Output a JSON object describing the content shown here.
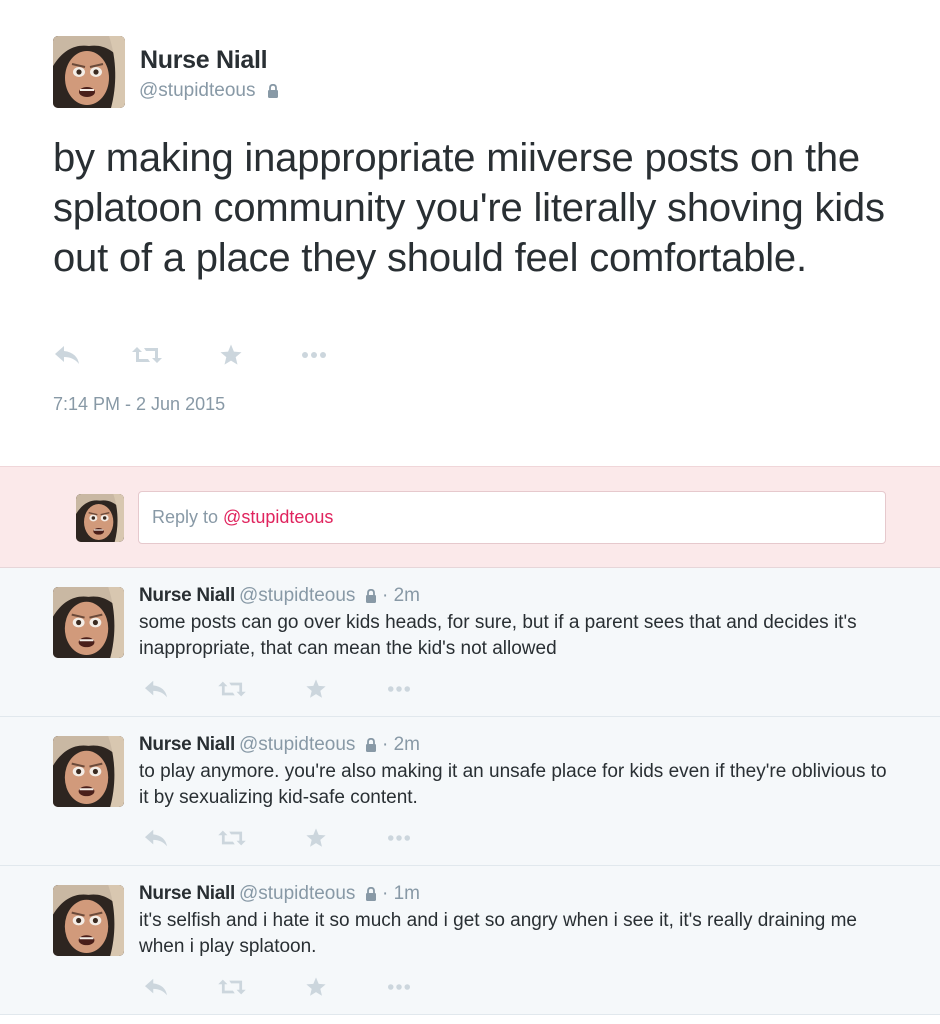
{
  "main_tweet": {
    "display_name": "Nurse Niall",
    "handle": "@stupidteous",
    "text": "by making inappropriate miiverse posts on the splatoon community you're literally shoving kids out of a place they should feel comfortable.",
    "timestamp": "7:14 PM - 2 Jun 2015",
    "actions": [
      "reply-icon",
      "retweet-icon",
      "favorite-icon",
      "more-icon"
    ]
  },
  "reply_box": {
    "placeholder_prefix": "Reply to ",
    "placeholder_mention": "@stupidteous"
  },
  "replies": [
    {
      "display_name": "Nurse Niall",
      "handle": "@stupidteous",
      "separator": " · ",
      "time": "2m",
      "text": "some posts can go over kids heads, for sure, but if a parent sees that and decides it's inappropriate, that can mean the kid's not allowed"
    },
    {
      "display_name": "Nurse Niall",
      "handle": "@stupidteous",
      "separator": " · ",
      "time": "2m",
      "text": "to play anymore. you're also making it an unsafe place for kids even if they're oblivious to it by sexualizing kid-safe content."
    },
    {
      "display_name": "Nurse Niall",
      "handle": "@stupidteous",
      "separator": " · ",
      "time": "1m",
      "text": "it's selfish and i hate it so much and i get so angry when i see it, it's really draining me when i play splatoon."
    }
  ],
  "colors": {
    "text": "#292f33",
    "muted": "#8899a6",
    "mention": "#e0245e",
    "reply_bg": "#fbe9ea",
    "thread_bg": "#f5f8fa",
    "icon": "#ccd6dd"
  }
}
